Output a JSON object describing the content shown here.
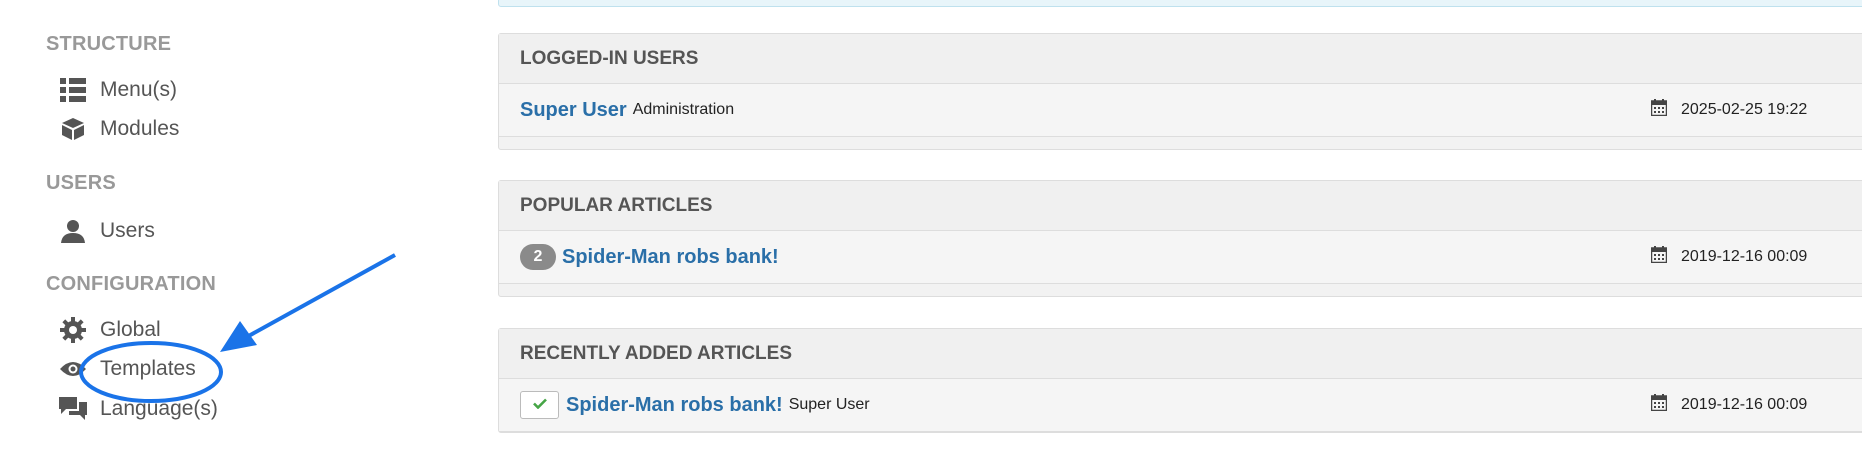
{
  "sidebar": {
    "structure_heading": "STRUCTURE",
    "users_heading": "USERS",
    "configuration_heading": "CONFIGURATION",
    "items": {
      "menus": "Menu(s)",
      "modules": "Modules",
      "users": "Users",
      "global": "Global",
      "templates": "Templates",
      "languages": "Language(s)"
    },
    "icons": {
      "menus": "list-icon",
      "modules": "cube-icon",
      "users": "user-icon",
      "global": "gear-icon",
      "templates": "eye-icon",
      "languages": "comments-icon"
    }
  },
  "logged_in_users": {
    "title": "LOGGED-IN USERS",
    "rows": [
      {
        "name": "Super User",
        "client": "Administration",
        "date": "2025-02-25 19:22"
      }
    ]
  },
  "popular_articles": {
    "title": "POPULAR ARTICLES",
    "rows": [
      {
        "hits": "2",
        "title": "Spider-Man robs bank!",
        "date": "2019-12-16 00:09"
      }
    ]
  },
  "recent_articles": {
    "title": "RECENTLY ADDED ARTICLES",
    "rows": [
      {
        "title": "Spider-Man robs bank!",
        "author": "Super User",
        "date": "2019-12-16 00:09"
      }
    ]
  },
  "colors": {
    "link": "#2a6fa8",
    "annotation": "#1a73e8",
    "published_check": "#46a546"
  }
}
